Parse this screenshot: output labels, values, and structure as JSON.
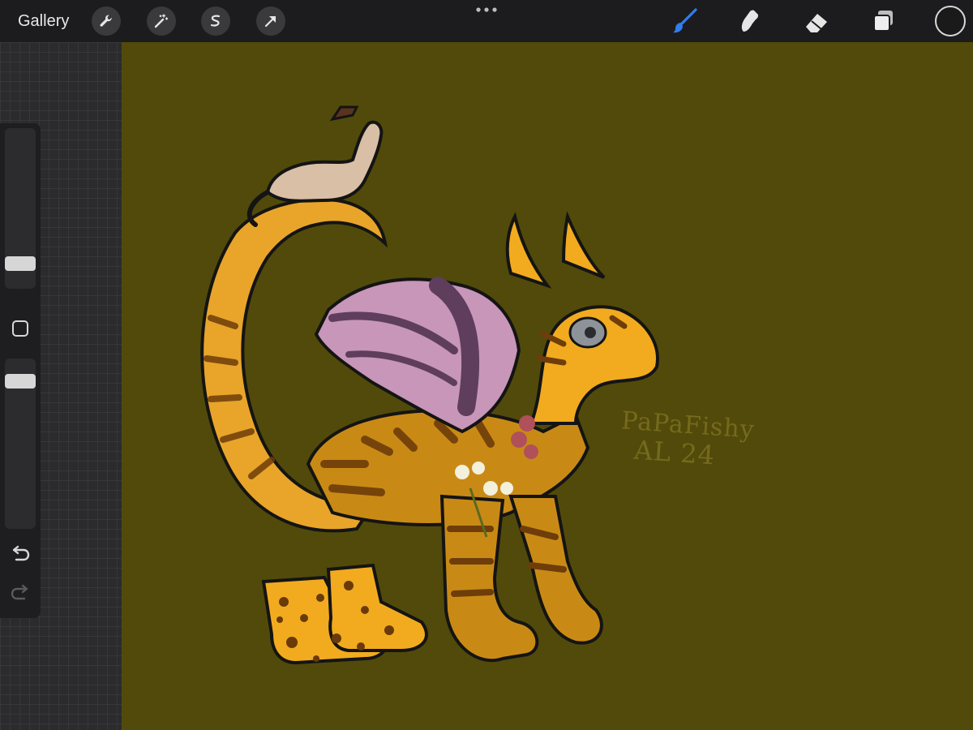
{
  "toolbar": {
    "gallery_label": "Gallery",
    "left_tools": [
      "wrench-icon",
      "magic-wand-icon",
      "selection-icon",
      "transform-arrow-icon"
    ],
    "right_tools": [
      "brush-icon",
      "smudge-icon",
      "eraser-icon",
      "layers-icon"
    ],
    "active_tool": "brush",
    "current_color": "#1a1a1a"
  },
  "sidebar": {
    "brush_size": 0.12,
    "opacity": 0.9
  },
  "canvas": {
    "background_color": "#524a0a",
    "signature_line1": "PaPaFishy",
    "signature_line2": "AL 24"
  },
  "colors": {
    "accent_blue": "#2f7df0",
    "toolbar_bg": "#1c1c1e"
  }
}
